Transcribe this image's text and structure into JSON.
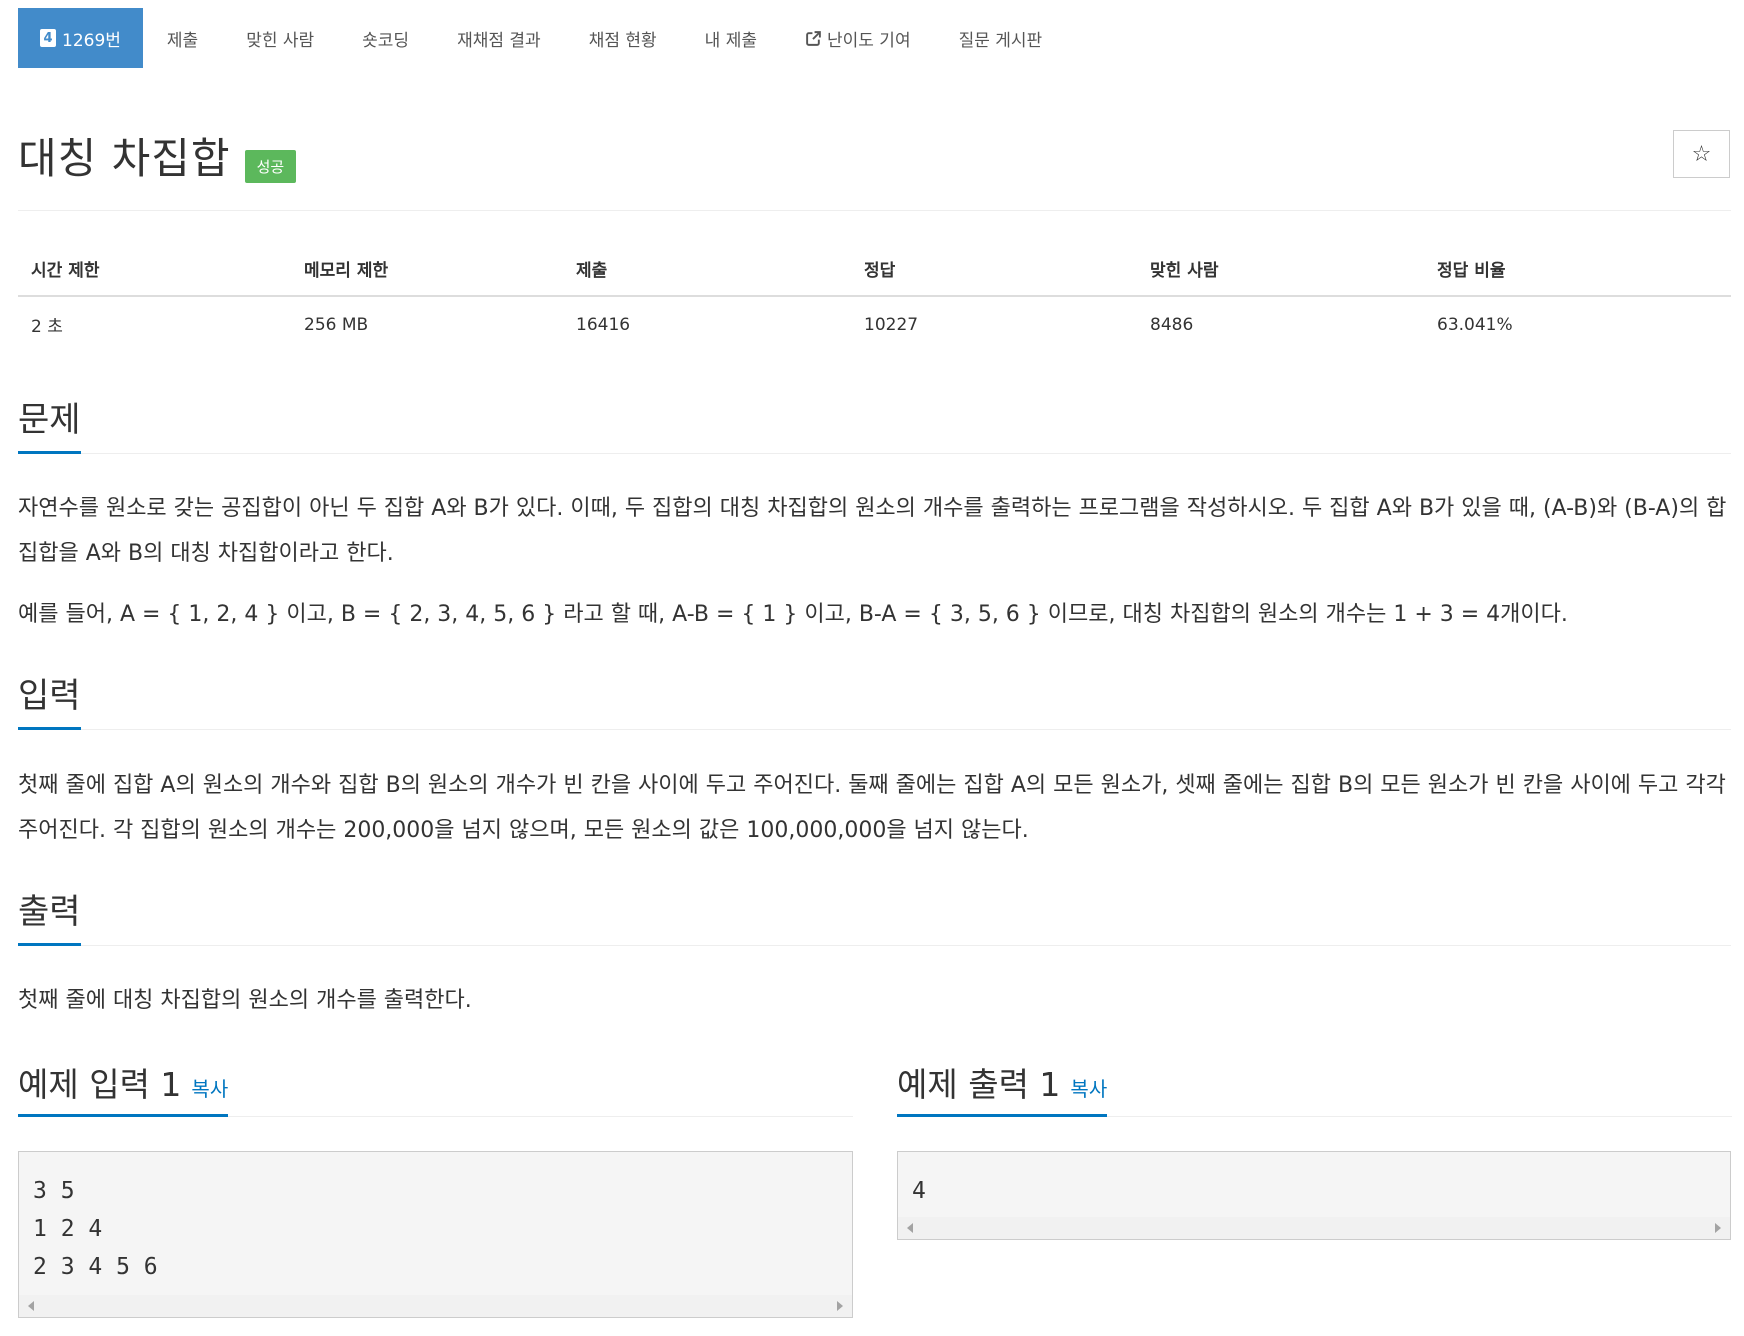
{
  "nav": {
    "problem_number_badge": "4",
    "items": [
      {
        "label": "1269번"
      },
      {
        "label": "제출"
      },
      {
        "label": "맞힌 사람"
      },
      {
        "label": "숏코딩"
      },
      {
        "label": "재채점 결과"
      },
      {
        "label": "채점 현황"
      },
      {
        "label": "내 제출"
      },
      {
        "label": "난이도 기여"
      },
      {
        "label": "질문 게시판"
      }
    ]
  },
  "problem": {
    "title": "대칭 차집합",
    "status_badge": "성공",
    "star_icon": "☆"
  },
  "info_table": {
    "headers": [
      "시간 제한",
      "메모리 제한",
      "제출",
      "정답",
      "맞힌 사람",
      "정답 비율"
    ],
    "values": [
      "2 초",
      "256 MB",
      "16416",
      "10227",
      "8486",
      "63.041%"
    ]
  },
  "sections": {
    "description": {
      "title": "문제",
      "p1": "자연수를 원소로 갖는 공집합이 아닌 두 집합 A와 B가 있다. 이때, 두 집합의 대칭 차집합의 원소의 개수를 출력하는 프로그램을 작성하시오. 두 집합 A와 B가 있을 때, (A-B)와 (B-A)의 합집합을 A와 B의 대칭 차집합이라고 한다.",
      "p2": "예를 들어, A = { 1, 2, 4 } 이고, B = { 2, 3, 4, 5, 6 } 라고 할 때,  A-B = { 1 } 이고, B-A = { 3, 5, 6 } 이므로, 대칭 차집합의 원소의 개수는 1 + 3 = 4개이다."
    },
    "input": {
      "title": "입력",
      "text": "첫째 줄에 집합 A의 원소의 개수와 집합 B의 원소의 개수가 빈 칸을 사이에 두고 주어진다. 둘째 줄에는 집합 A의 모든 원소가, 셋째 줄에는 집합 B의 모든 원소가 빈 칸을 사이에 두고 각각 주어진다. 각 집합의 원소의 개수는 200,000을 넘지 않으며, 모든 원소의 값은 100,000,000을 넘지 않는다."
    },
    "output": {
      "title": "출력",
      "text": "첫째 줄에 대칭 차집합의 원소의 개수를 출력한다."
    }
  },
  "samples": {
    "input": {
      "title": "예제 입력 1",
      "copy_label": "복사",
      "content": "3 5\n1 2 4\n2 3 4 5 6"
    },
    "output": {
      "title": "예제 출력 1",
      "copy_label": "복사",
      "content": "4"
    }
  },
  "colors": {
    "active_tab": "#428bca",
    "success_badge": "#5cb85c",
    "section_underline": "#0076c0"
  }
}
